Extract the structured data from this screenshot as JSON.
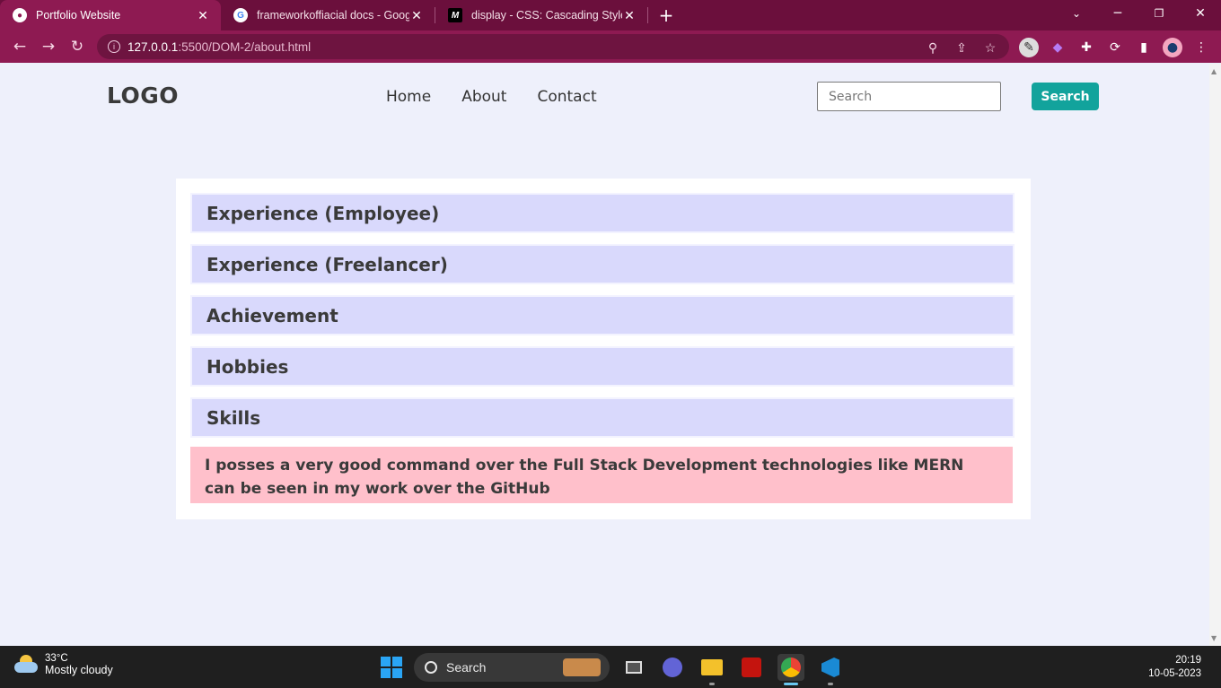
{
  "browser": {
    "tabs": [
      {
        "title": "Portfolio Website",
        "active": true
      },
      {
        "title": "frameworkoffiacial docs - Google",
        "active": false
      },
      {
        "title": "display - CSS: Cascading Style Sh",
        "active": false
      }
    ],
    "url_host": "127.0.0.1",
    "url_path": ":5500/DOM-2/about.html"
  },
  "site": {
    "logo": "LOGO",
    "nav": [
      "Home",
      "About",
      "Contact"
    ],
    "search_placeholder": "Search",
    "search_button": "Search"
  },
  "accordion": {
    "items": [
      "Experience (Employee)",
      "Experience (Freelancer)",
      "Achievement",
      "Hobbies",
      "Skills"
    ],
    "expanded_content": "I posses a very good command over the Full Stack Development technologies like MERN can be seen in my work over the GitHub"
  },
  "taskbar": {
    "temperature": "33°C",
    "weather": "Mostly cloudy",
    "search_label": "Search",
    "time": "20:19",
    "date": "10-05-2023"
  },
  "colors": {
    "tab_bar": "#6b0f3c",
    "toolbar": "#8e1a52",
    "page_bg": "#eef0fb",
    "accordion_header": "#d9d9fc",
    "accordion_body": "#ffc0cb",
    "search_button": "#12a39c"
  }
}
